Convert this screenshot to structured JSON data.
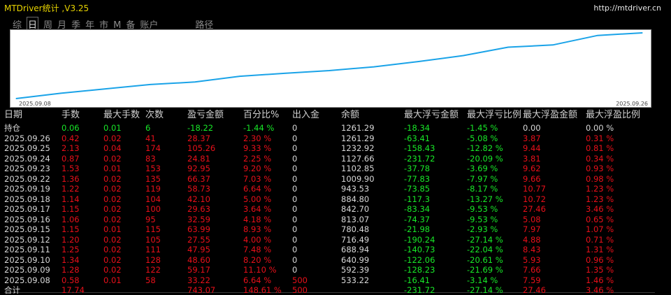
{
  "title": "MTDriver统计 ,V3.25",
  "url": "http://mtdriver.cn",
  "tabs": [
    {
      "label": "综",
      "active": false
    },
    {
      "label": "日",
      "active": true
    },
    {
      "label": "周",
      "active": false
    },
    {
      "label": "月",
      "active": false
    },
    {
      "label": "季",
      "active": false
    },
    {
      "label": "年",
      "active": false
    },
    {
      "label": "市",
      "active": false
    },
    {
      "label": "M",
      "active": false
    },
    {
      "label": "备",
      "active": false
    },
    {
      "label": "账户",
      "active": false
    },
    {
      "label": "路径",
      "active": false
    }
  ],
  "chart_data": {
    "type": "line",
    "x_start_label": "2025.09.08",
    "x_end_label": "2025.09.26",
    "x": [
      "2025.09.08",
      "2025.09.09",
      "2025.09.10",
      "2025.09.11",
      "2025.09.12",
      "2025.09.15",
      "2025.09.16",
      "2025.09.17",
      "2025.09.18",
      "2025.09.19",
      "2025.09.22",
      "2025.09.23",
      "2025.09.24",
      "2025.09.25",
      "2025.09.26"
    ],
    "values": [
      533.22,
      592.39,
      640.99,
      688.94,
      716.49,
      780.48,
      813.07,
      842.7,
      884.8,
      943.53,
      1009.9,
      1102.85,
      1127.66,
      1232.92,
      1261.29
    ],
    "ylim": [
      533.22,
      1261.29
    ],
    "line_color": "#1aa3e8"
  },
  "table": {
    "headers": [
      "日期",
      "手数",
      "最大手数",
      "次数",
      "盈亏金额",
      "百分比%",
      "出入金",
      "余额",
      "最大浮亏金额",
      "最大浮亏比例",
      "最大浮盈金额",
      "最大浮盈比例"
    ],
    "rows": [
      {
        "cells": [
          "持仓",
          "0.06",
          "0.01",
          "6",
          "-18.22",
          "-1.44 %",
          "0",
          "1261.29",
          "-18.34",
          "-1.45 %",
          "0.00",
          "0.00 %"
        ],
        "colors": [
          "white",
          "green",
          "green",
          "green",
          "green",
          "green",
          "white",
          "white",
          "green",
          "green",
          "white",
          "white"
        ]
      },
      {
        "cells": [
          "2025.09.26",
          "0.42",
          "0.02",
          "41",
          "28.37",
          "2.30 %",
          "0",
          "1261.29",
          "-63.41",
          "-5.08 %",
          "3.87",
          "0.31 %"
        ],
        "colors": [
          "white",
          "red",
          "red",
          "red",
          "red",
          "red",
          "white",
          "white",
          "green",
          "green",
          "red",
          "red"
        ]
      },
      {
        "cells": [
          "2025.09.25",
          "2.13",
          "0.04",
          "174",
          "105.26",
          "9.33 %",
          "0",
          "1232.92",
          "-158.43",
          "-12.82 %",
          "9.44",
          "0.81 %"
        ],
        "colors": [
          "white",
          "red",
          "red",
          "red",
          "red",
          "red",
          "white",
          "white",
          "green",
          "green",
          "red",
          "red"
        ]
      },
      {
        "cells": [
          "2025.09.24",
          "0.87",
          "0.02",
          "83",
          "24.81",
          "2.25 %",
          "0",
          "1127.66",
          "-231.72",
          "-20.09 %",
          "3.81",
          "0.34 %"
        ],
        "colors": [
          "white",
          "red",
          "red",
          "red",
          "red",
          "red",
          "white",
          "white",
          "green",
          "green",
          "red",
          "red"
        ]
      },
      {
        "cells": [
          "2025.09.23",
          "1.53",
          "0.01",
          "153",
          "92.95",
          "9.20 %",
          "0",
          "1102.85",
          "-37.78",
          "-3.69 %",
          "9.62",
          "0.93 %"
        ],
        "colors": [
          "white",
          "red",
          "red",
          "red",
          "red",
          "red",
          "white",
          "white",
          "green",
          "green",
          "red",
          "red"
        ]
      },
      {
        "cells": [
          "2025.09.22",
          "1.36",
          "0.02",
          "135",
          "66.37",
          "7.03 %",
          "0",
          "1009.90",
          "-77.83",
          "-7.97 %",
          "9.66",
          "0.98 %"
        ],
        "colors": [
          "white",
          "red",
          "red",
          "red",
          "red",
          "red",
          "white",
          "white",
          "green",
          "green",
          "red",
          "red"
        ]
      },
      {
        "cells": [
          "2025.09.19",
          "1.22",
          "0.02",
          "119",
          "58.73",
          "6.64 %",
          "0",
          "943.53",
          "-73.85",
          "-8.17 %",
          "10.77",
          "1.23 %"
        ],
        "colors": [
          "white",
          "red",
          "red",
          "red",
          "red",
          "red",
          "white",
          "white",
          "green",
          "green",
          "red",
          "red"
        ]
      },
      {
        "cells": [
          "2025.09.18",
          "1.14",
          "0.02",
          "104",
          "42.10",
          "5.00 %",
          "0",
          "884.80",
          "-117.3",
          "-13.27 %",
          "10.72",
          "1.23 %"
        ],
        "colors": [
          "white",
          "red",
          "red",
          "red",
          "red",
          "red",
          "white",
          "white",
          "green",
          "green",
          "red",
          "red"
        ]
      },
      {
        "cells": [
          "2025.09.17",
          "1.15",
          "0.02",
          "100",
          "29.63",
          "3.64 %",
          "0",
          "842.70",
          "-83.34",
          "-9.53 %",
          "27.46",
          "3.46 %"
        ],
        "colors": [
          "white",
          "red",
          "red",
          "red",
          "red",
          "red",
          "white",
          "white",
          "green",
          "green",
          "red",
          "red"
        ]
      },
      {
        "cells": [
          "2025.09.16",
          "1.06",
          "0.02",
          "95",
          "32.59",
          "4.18 %",
          "0",
          "813.07",
          "-74.37",
          "-9.53 %",
          "5.08",
          "0.65 %"
        ],
        "colors": [
          "white",
          "red",
          "red",
          "red",
          "red",
          "red",
          "white",
          "white",
          "green",
          "green",
          "red",
          "red"
        ]
      },
      {
        "cells": [
          "2025.09.15",
          "1.15",
          "0.01",
          "115",
          "63.99",
          "8.93 %",
          "0",
          "780.48",
          "-21.98",
          "-2.93 %",
          "7.97",
          "1.07 %"
        ],
        "colors": [
          "white",
          "red",
          "red",
          "red",
          "red",
          "red",
          "white",
          "white",
          "green",
          "green",
          "red",
          "red"
        ]
      },
      {
        "cells": [
          "2025.09.12",
          "1.20",
          "0.02",
          "105",
          "27.55",
          "4.00 %",
          "0",
          "716.49",
          "-190.24",
          "-27.14 %",
          "4.88",
          "0.71 %"
        ],
        "colors": [
          "white",
          "red",
          "red",
          "red",
          "red",
          "red",
          "white",
          "white",
          "green",
          "green",
          "red",
          "red"
        ]
      },
      {
        "cells": [
          "2025.09.11",
          "1.25",
          "0.02",
          "111",
          "47.95",
          "7.48 %",
          "0",
          "688.94",
          "-140.73",
          "-22.04 %",
          "8.43",
          "1.31 %"
        ],
        "colors": [
          "white",
          "red",
          "red",
          "red",
          "red",
          "red",
          "white",
          "white",
          "green",
          "green",
          "red",
          "red"
        ]
      },
      {
        "cells": [
          "2025.09.10",
          "1.34",
          "0.02",
          "128",
          "48.60",
          "8.20 %",
          "0",
          "640.99",
          "-122.06",
          "-20.61 %",
          "5.93",
          "0.96 %"
        ],
        "colors": [
          "white",
          "red",
          "red",
          "red",
          "red",
          "red",
          "white",
          "white",
          "green",
          "green",
          "red",
          "red"
        ]
      },
      {
        "cells": [
          "2025.09.09",
          "1.28",
          "0.02",
          "122",
          "59.17",
          "11.10 %",
          "0",
          "592.39",
          "-128.23",
          "-21.69 %",
          "7.66",
          "1.35 %"
        ],
        "colors": [
          "white",
          "red",
          "red",
          "red",
          "red",
          "red",
          "white",
          "white",
          "green",
          "green",
          "red",
          "red"
        ]
      },
      {
        "cells": [
          "2025.09.08",
          "0.58",
          "0.01",
          "58",
          "33.22",
          "6.64 %",
          "500",
          "533.22",
          "-16.41",
          "-3.14 %",
          "7.59",
          "1.46 %"
        ],
        "colors": [
          "white",
          "red",
          "red",
          "red",
          "red",
          "red",
          "red",
          "white",
          "green",
          "green",
          "red",
          "red"
        ]
      },
      {
        "cells": [
          "合计",
          "17.74",
          "",
          "",
          "743.07",
          "148.61 %",
          "500",
          "",
          "-231.72",
          "-27.14 %",
          "27.46",
          "3.46 %"
        ],
        "colors": [
          "white",
          "red",
          "red",
          "red",
          "red",
          "red",
          "red",
          "white",
          "green",
          "green",
          "red",
          "red"
        ]
      }
    ]
  }
}
